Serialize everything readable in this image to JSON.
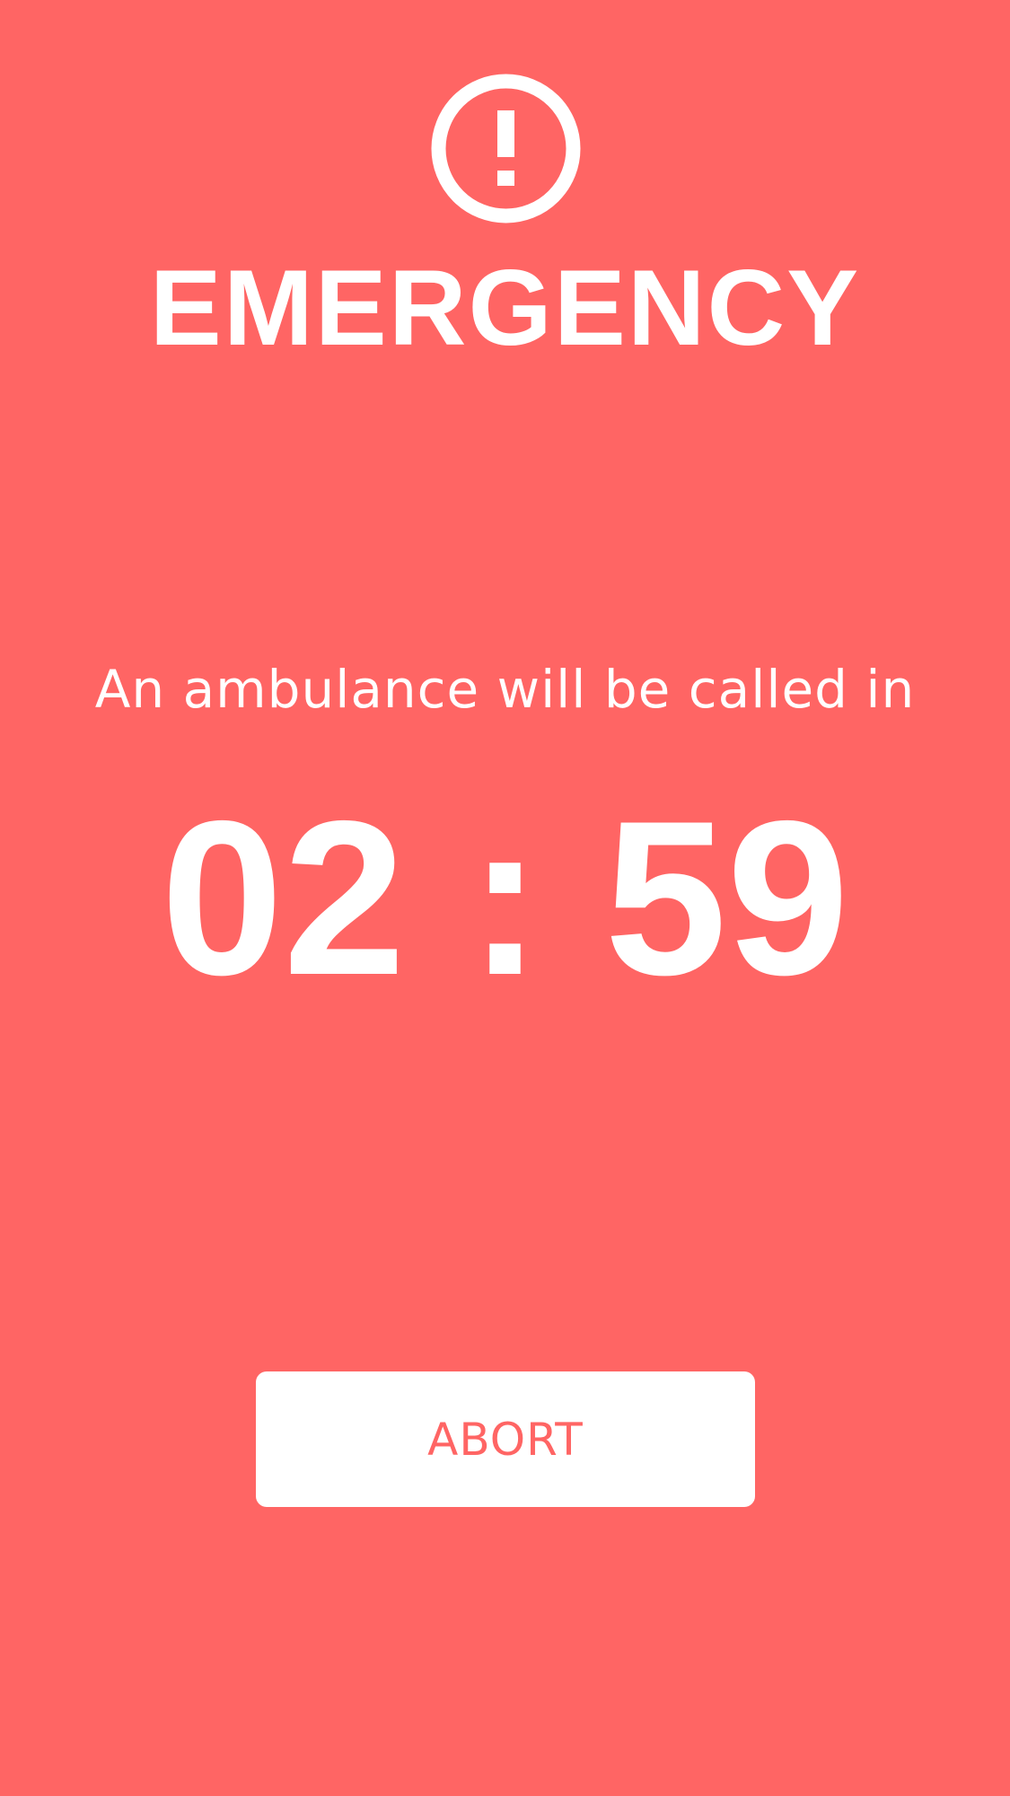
{
  "colors": {
    "background": "#FF6564",
    "foreground": "#FFFFFF",
    "button_text": "#FF6564"
  },
  "header": {
    "icon": "exclamation-circle-icon",
    "title": "EMERGENCY"
  },
  "message": {
    "text": "An ambulance will be called in"
  },
  "countdown": {
    "minutes": "02",
    "separator": ":",
    "seconds": "59"
  },
  "actions": {
    "abort_label": "ABORT"
  }
}
